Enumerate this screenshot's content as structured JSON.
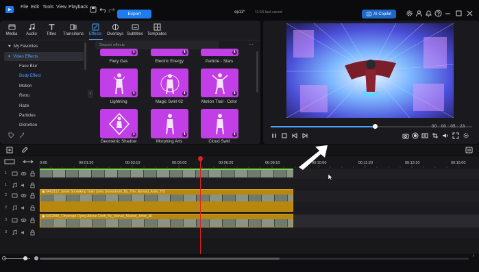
{
  "menubar": {
    "items": [
      "File",
      "Edit",
      "Tools",
      "View",
      "Playback"
    ],
    "export_label": "Export",
    "project_title": "ep11*",
    "project_status": "11:16 last saved",
    "copilot_label": "AI Copilot"
  },
  "tabs": [
    {
      "label": "Media",
      "icon": "media-icon"
    },
    {
      "label": "Audio",
      "icon": "music-note-icon"
    },
    {
      "label": "Titles",
      "icon": "text-t-icon"
    },
    {
      "label": "Transitions",
      "icon": "transitions-icon"
    },
    {
      "label": "Effects",
      "icon": "effects-icon",
      "active": true
    },
    {
      "label": "Overlays",
      "icon": "overlays-icon"
    },
    {
      "label": "Subtitles",
      "icon": "subtitles-icon"
    },
    {
      "label": "Templates",
      "icon": "templates-icon"
    }
  ],
  "sidebar": {
    "items": [
      {
        "label": "My Favorites",
        "type": "category"
      },
      {
        "label": "Video Effects",
        "type": "category",
        "expanded": true
      },
      {
        "label": "Face Blur"
      },
      {
        "label": "Body Effect",
        "active": true
      },
      {
        "label": "Motion"
      },
      {
        "label": "Retro"
      },
      {
        "label": "Haze"
      },
      {
        "label": "Particles"
      },
      {
        "label": "Distortion"
      }
    ]
  },
  "search": {
    "placeholder": "Search effects"
  },
  "effects": [
    {
      "label": "Fiery Gas"
    },
    {
      "label": "Electric Energy"
    },
    {
      "label": "Particle - Stars"
    },
    {
      "label": "Lightning"
    },
    {
      "label": "Magic Swirl 02"
    },
    {
      "label": "Motion Trail - Color"
    },
    {
      "label": "Geometric Shadow"
    },
    {
      "label": "Morphing Arts"
    },
    {
      "label": "Cloud Swirl"
    }
  ],
  "preview": {
    "timecode": "00 : 00 : 05 : 23",
    "progress": 0.52
  },
  "timeline": {
    "ruler_labels": [
      "0:00",
      "00:01:20",
      "00:03:10",
      "00:05:00",
      "00:06:20",
      "00:08:10",
      "00:10:00",
      "00:11:20",
      "00:13:10",
      "00:15:00"
    ],
    "tracks": [
      {
        "num": "1",
        "kind": "video"
      },
      {
        "num": "1",
        "kind": "audio"
      },
      {
        "num": "2",
        "kind": "video"
      },
      {
        "num": "2",
        "kind": "audio"
      },
      {
        "num": "3",
        "kind": "video"
      },
      {
        "num": "3",
        "kind": "audio"
      }
    ],
    "clips": [
      {
        "title": "6462112_Snow Snowlking Train Lines Snowstorm_By_The_Nomad_Artist_HD"
      },
      {
        "title": "6402845_Cityscape Flying Above Cloth_By_Marvel_Mussio_Artist_4K"
      }
    ]
  },
  "colors": {
    "accent": "#4da3ff",
    "export_button": "#1e7bf0",
    "effect_thumb": "#c23ee6",
    "playhead": "#e02020",
    "clip_gold": "#b8870d"
  }
}
